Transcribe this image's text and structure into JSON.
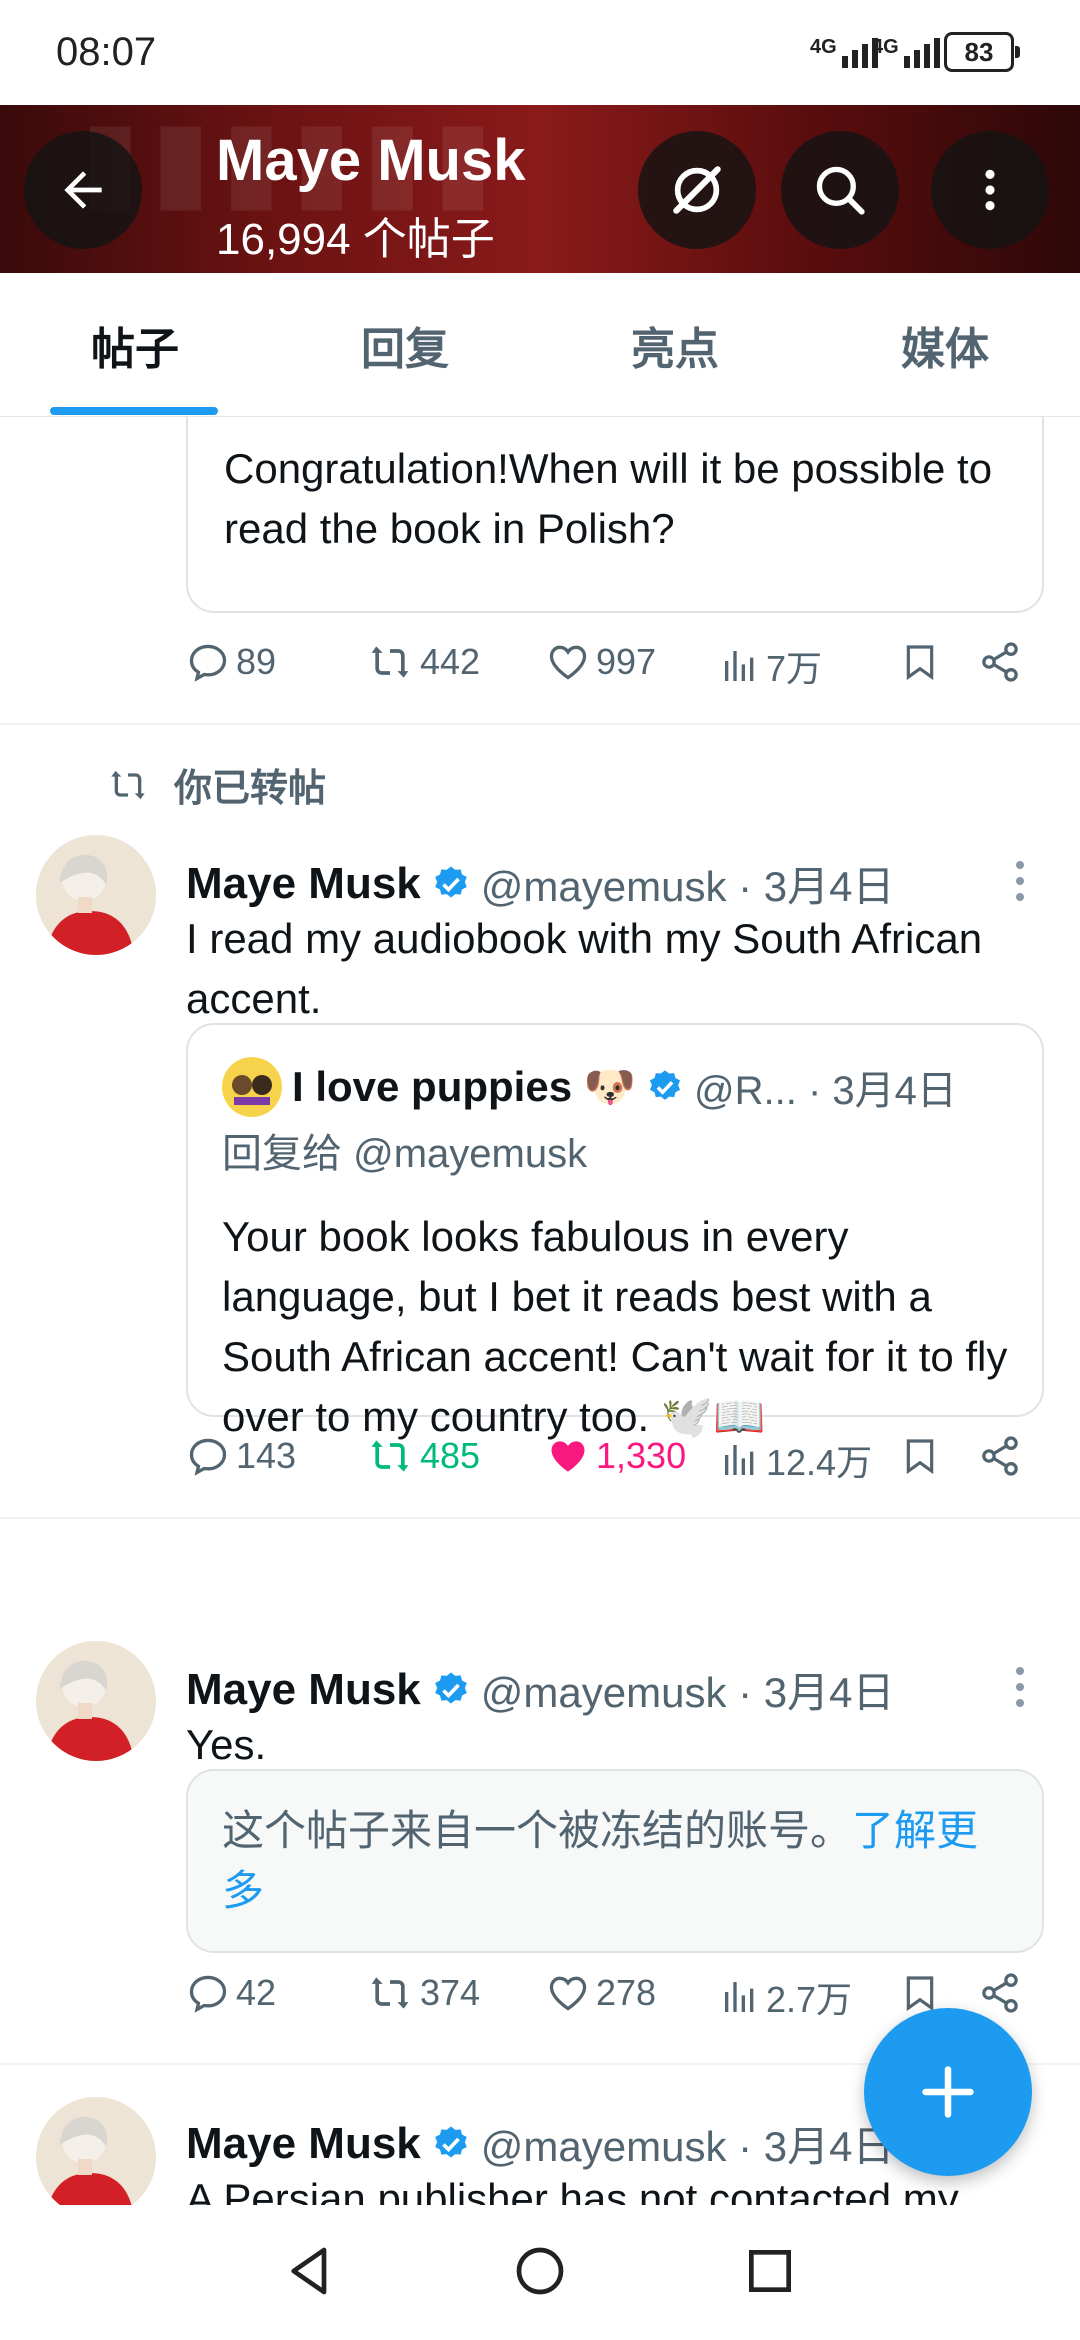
{
  "status_bar": {
    "time": "08:07",
    "network1": "4G",
    "network2": "4G",
    "battery": "83"
  },
  "header": {
    "name": "Maye Musk",
    "post_count": "16,994 个帖子"
  },
  "tabs": [
    {
      "label": "帖子",
      "active": true
    },
    {
      "label": "回复",
      "active": false
    },
    {
      "label": "亮点",
      "active": false
    },
    {
      "label": "媒体",
      "active": false
    }
  ],
  "tweet0": {
    "quote_text": "Congratulation!When will it be possible to read the book in Polish?",
    "replies": "89",
    "retweets": "442",
    "likes": "997",
    "views": "7万"
  },
  "tweet1": {
    "retweet_label": "你已转帖",
    "name": "Maye Musk",
    "handle": "@mayemusk · 3月4日",
    "text": "I read my audiobook with my South African accent.",
    "quote": {
      "name": "I love puppies 🐶",
      "handle": "@R... · 3月4日",
      "reply_to": "回复给 @mayemusk",
      "text": "Your book looks fabulous in every language, but I bet it reads best with a South African accent! Can't wait for it to fly over to my country too. 🕊️📖"
    },
    "replies": "143",
    "retweets": "485",
    "likes": "1,330",
    "views": "12.4万"
  },
  "tweet2": {
    "name": "Maye Musk",
    "handle": "@mayemusk · 3月4日",
    "text": "Yes.",
    "notice": "这个帖子来自一个被冻结的账号。",
    "notice_link": "了解更多",
    "replies": "42",
    "retweets": "374",
    "likes": "278",
    "views": "2.7万"
  },
  "tweet3": {
    "name": "Maye Musk",
    "handle": "@mayemusk · 3月4日",
    "text": "A Persian publisher has not contacted my"
  },
  "colors": {
    "accent": "#1d9bf0",
    "retweeted": "#00ba7c",
    "liked": "#f91880"
  },
  "icons": [
    "back-arrow-icon",
    "grok-icon",
    "search-icon",
    "more-vertical-icon",
    "reply-icon",
    "retweet-icon",
    "like-icon",
    "views-icon",
    "bookmark-icon",
    "share-icon",
    "verified-badge-icon",
    "plus-icon",
    "nav-back-icon",
    "nav-home-icon",
    "nav-recents-icon"
  ]
}
